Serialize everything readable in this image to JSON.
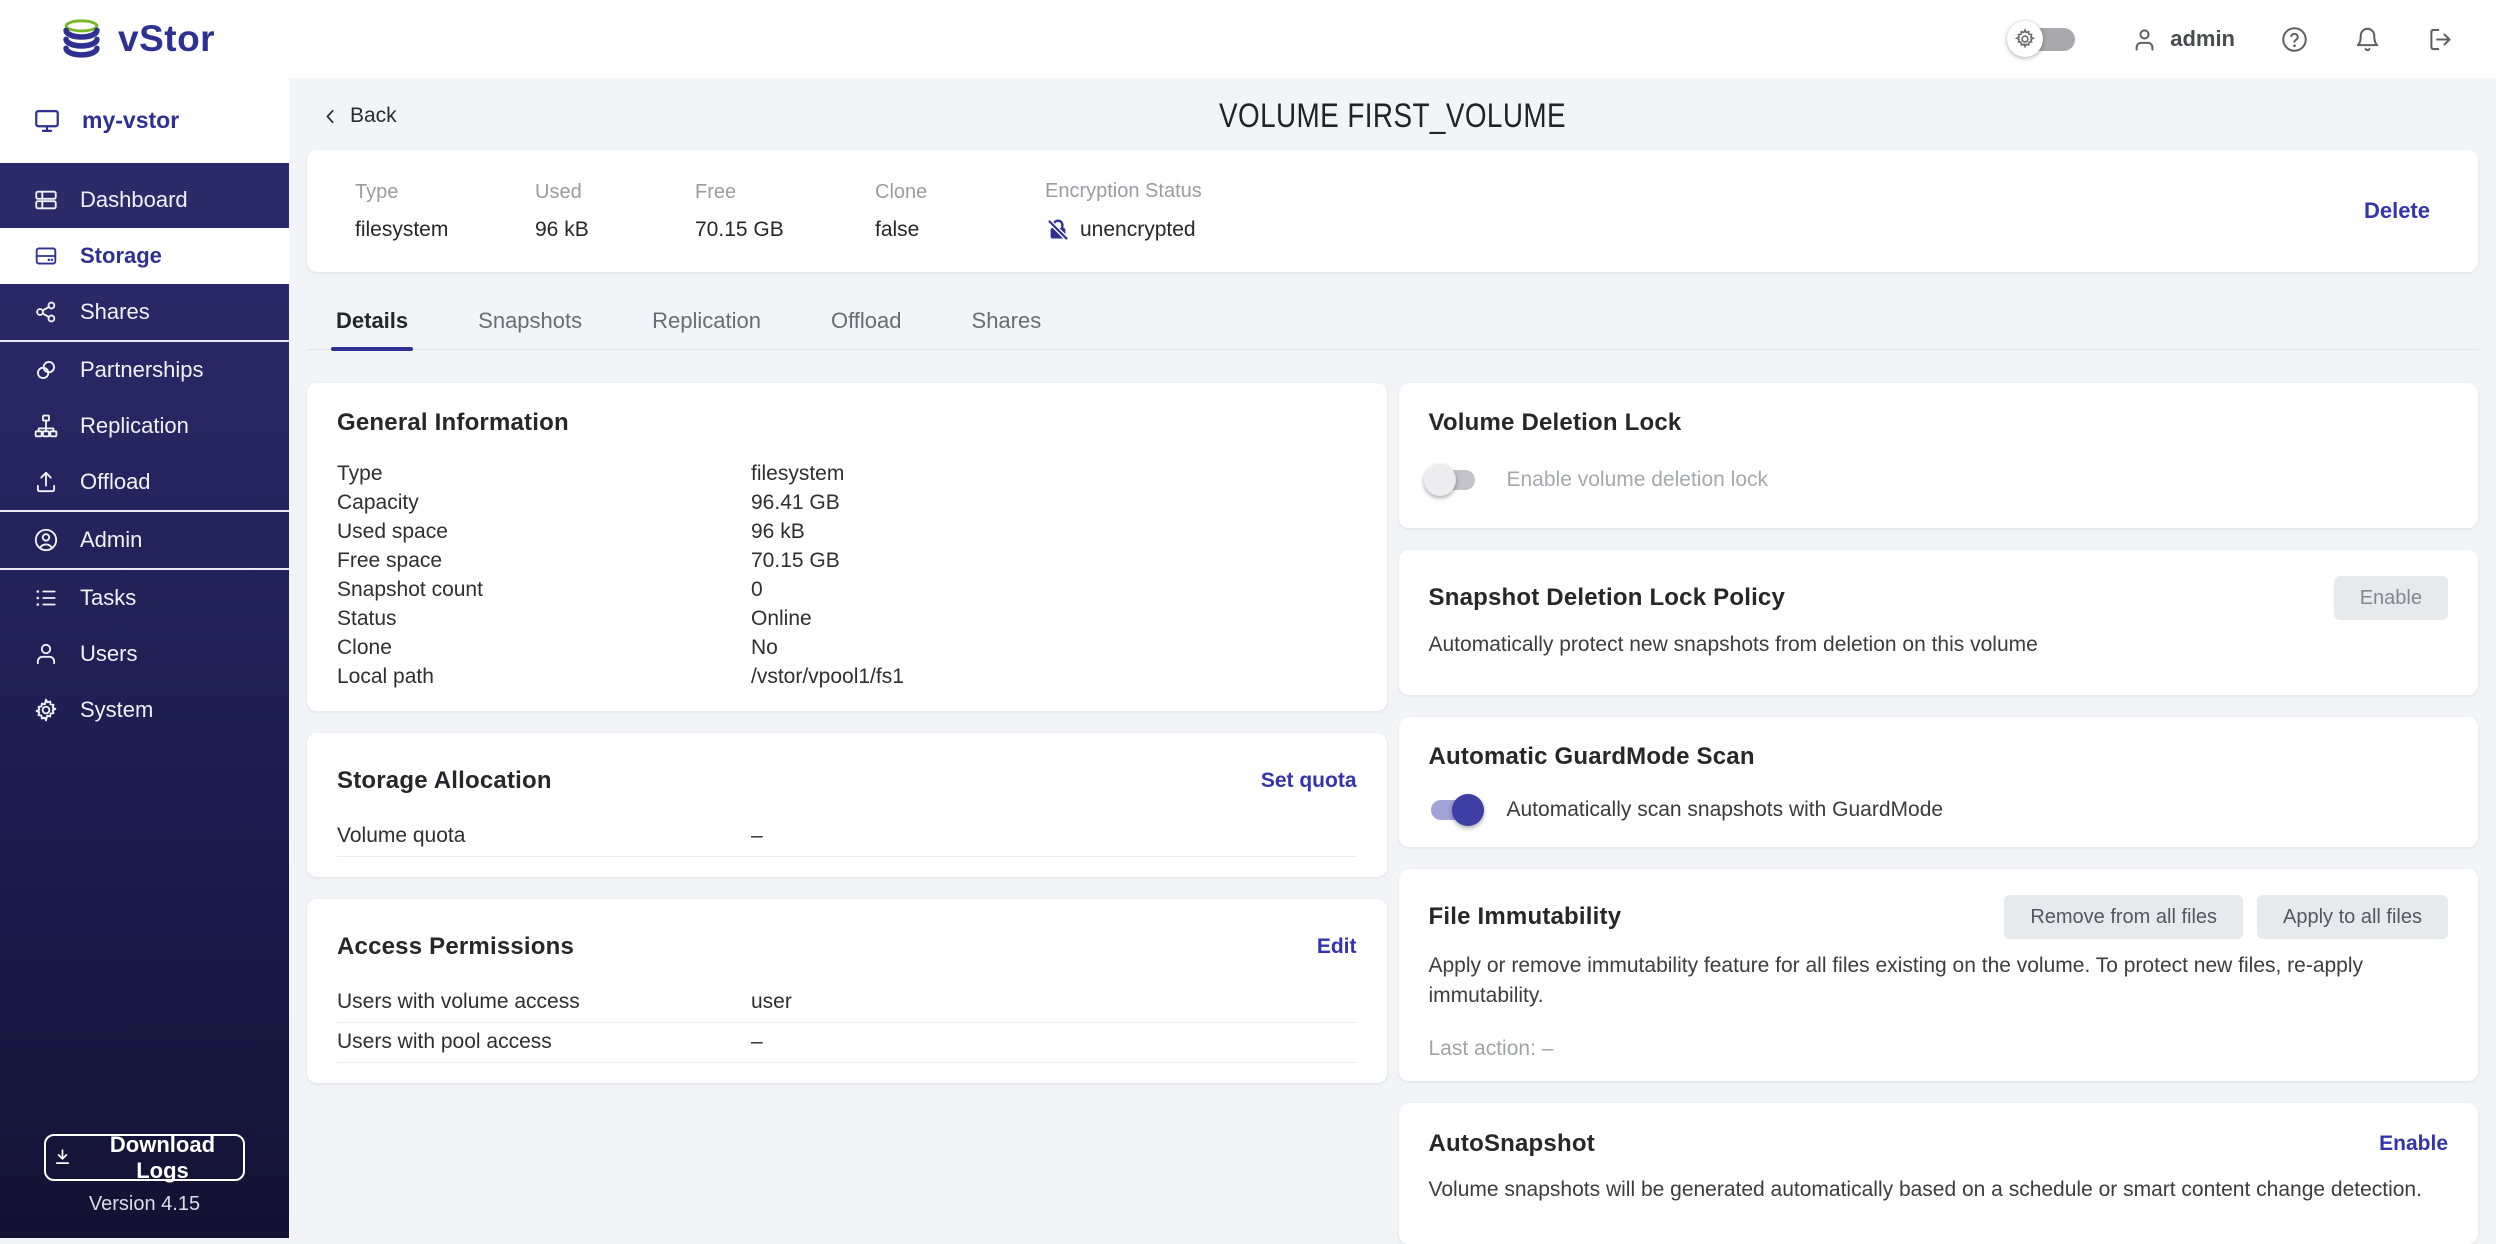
{
  "header": {
    "logo_text": "vStor",
    "user_label": "admin"
  },
  "sidebar": {
    "host_label": "my-vstor",
    "items": [
      {
        "label": "Dashboard",
        "state": "normal"
      },
      {
        "label": "Storage",
        "state": "active"
      },
      {
        "label": "Shares",
        "state": "normal"
      },
      {
        "label": "Partnerships",
        "state": "normal"
      },
      {
        "label": "Replication",
        "state": "normal"
      },
      {
        "label": "Offload",
        "state": "normal"
      },
      {
        "label": "Admin",
        "state": "normal"
      },
      {
        "label": "Tasks",
        "state": "normal"
      },
      {
        "label": "Users",
        "state": "normal"
      },
      {
        "label": "System",
        "state": "normal"
      }
    ],
    "download_logs_label": "Download Logs",
    "version_label": "Version 4.15"
  },
  "page": {
    "back_label": "Back",
    "title": "VOLUME FIRST_VOLUME"
  },
  "summary": {
    "stats": [
      {
        "label": "Type",
        "value": "filesystem"
      },
      {
        "label": "Used",
        "value": "96 kB"
      },
      {
        "label": "Free",
        "value": "70.15 GB"
      },
      {
        "label": "Clone",
        "value": "false"
      },
      {
        "label": "Encryption Status",
        "value": "unencrypted"
      }
    ],
    "delete_label": "Delete"
  },
  "tabs": [
    {
      "label": "Details",
      "state": "active"
    },
    {
      "label": "Snapshots",
      "state": "normal"
    },
    {
      "label": "Replication",
      "state": "normal"
    },
    {
      "label": "Offload",
      "state": "normal"
    },
    {
      "label": "Shares",
      "state": "normal"
    }
  ],
  "panels": {
    "general_info": {
      "title": "General Information",
      "rows": [
        {
          "label": "Type",
          "value": "filesystem"
        },
        {
          "label": "Capacity",
          "value": "96.41 GB"
        },
        {
          "label": "Used space",
          "value": "96 kB"
        },
        {
          "label": "Free space",
          "value": "70.15 GB"
        },
        {
          "label": "Snapshot count",
          "value": "0"
        },
        {
          "label": "Status",
          "value": "Online"
        },
        {
          "label": "Clone",
          "value": "No"
        },
        {
          "label": "Local path",
          "value": "/vstor/vpool1/fs1"
        }
      ]
    },
    "storage_allocation": {
      "title": "Storage Allocation",
      "action_label": "Set quota",
      "rows": [
        {
          "label": "Volume quota",
          "value": "–"
        }
      ]
    },
    "access_permissions": {
      "title": "Access Permissions",
      "action_label": "Edit",
      "rows": [
        {
          "label": "Users with volume access",
          "value": "user"
        },
        {
          "label": "Users with pool access",
          "value": "–"
        }
      ]
    },
    "volume_deletion_lock": {
      "title": "Volume Deletion Lock",
      "toggle_label": "Enable volume deletion lock",
      "toggle_state": "off"
    },
    "snapshot_deletion_lock": {
      "title": "Snapshot Deletion Lock Policy",
      "action_label": "Enable",
      "description": "Automatically protect new snapshots from deletion on this volume"
    },
    "guardmode_scan": {
      "title": "Automatic GuardMode Scan",
      "toggle_label": "Automatically scan snapshots with GuardMode",
      "toggle_state": "on"
    },
    "file_immutability": {
      "title": "File Immutability",
      "remove_label": "Remove from all files",
      "apply_label": "Apply to all files",
      "description": "Apply or remove immutability feature for all files existing on the volume. To protect new files, re-apply immutability.",
      "last_action": "Last action: –"
    },
    "autosnapshot": {
      "title": "AutoSnapshot",
      "action_label": "Enable",
      "description": "Volume snapshots will be generated automatically based on a schedule or smart content change detection."
    }
  },
  "icons": {
    "logo": "database-stack-icon",
    "header": [
      "theme-toggle-gear-icon",
      "user-icon",
      "help-icon",
      "bell-icon",
      "logout-icon"
    ],
    "sidebar": [
      "monitor-icon",
      "dashboard-icon",
      "storage-drive-icon",
      "share-icon",
      "link-icon",
      "hierarchy-icon",
      "upload-icon",
      "admin-user-circle-icon",
      "task-list-icon",
      "user-icon",
      "gear-icon",
      "download-icon"
    ],
    "content": [
      "chevron-left-icon",
      "lock-slash-icon"
    ]
  },
  "colors": {
    "brand_navy": "#2e3192",
    "logo_green": "#76b82a",
    "link_blue": "#3434ae",
    "sidebar_top": "#2c2d6d",
    "sidebar_bottom": "#131233",
    "toggle_on_thumb": "#3d3da4",
    "toggle_on_track": "#a2a3d8",
    "content_bg": "#f3f4f8"
  }
}
